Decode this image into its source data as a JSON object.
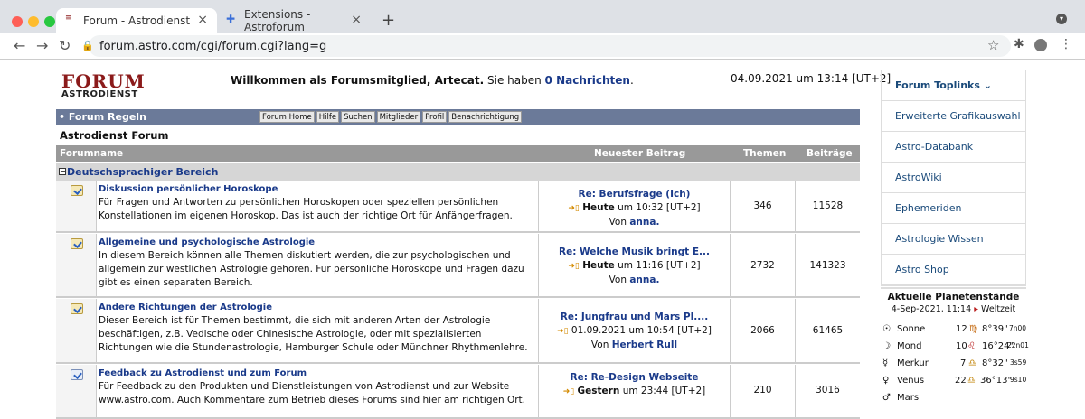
{
  "browser": {
    "tabs": [
      {
        "title": "Forum - Astrodienst",
        "close": "×"
      },
      {
        "title": "Extensions - Astroforum",
        "close": "×"
      }
    ],
    "new_tab": "+",
    "url": "forum.astro.com/cgi/forum.cgi?lang=g",
    "icons": [
      "back-arrow-icon",
      "forward-arrow-icon",
      "reload-icon",
      "star-icon",
      "puzzle-icon",
      "profile-icon",
      "menu-icon"
    ]
  },
  "header": {
    "logo_top": "FORUM",
    "logo_bottom": "ASTRODIENST",
    "welcome_bold": "Willkommen als Forumsmitglied, Artecat.",
    "welcome_mid": "Sie haben",
    "messages": "0 Nachrichten",
    "welcome_end": ".",
    "datetime": "04.09.2021 um 13:14 [UT+2]"
  },
  "nav": {
    "regeln": "• Forum Regeln",
    "buttons": [
      "Forum Home",
      "Hilfe",
      "Suchen",
      "Mitglieder",
      "Profil",
      "Benachrichtigung"
    ]
  },
  "forum_title": "Astrodienst Forum",
  "table": {
    "columns": [
      "Forumname",
      "Neuester Beitrag",
      "Themen",
      "Beiträge"
    ],
    "section": "Deutschsprachiger Bereich",
    "rows": [
      {
        "title": "Diskussion persönlicher Horoskope",
        "desc": "Für Fragen und Antworten zu persönlichen Horoskopen oder speziellen persönlichen Konstellationen im eigenen Horoskop. Das ist auch der richtige Ort für Anfängerfragen.",
        "latest_title": "Re: Berufsfrage (Ich)",
        "latest_day": "Heute",
        "latest_time": "um 10:32 [UT+2]",
        "by_label": "Von",
        "by": "anna.",
        "themen": "346",
        "beitraege": "11528"
      },
      {
        "title": "Allgemeine und psychologische Astrologie",
        "desc": "In diesem Bereich können alle Themen diskutiert werden, die zur psychologischen und allgemein zur westlichen Astrologie gehören. Für persönliche Horoskope und Fragen dazu gibt es einen separaten Bereich.",
        "latest_title": "Re: Welche Musik bringt E...",
        "latest_day": "Heute",
        "latest_time": "um 11:16 [UT+2]",
        "by_label": "Von",
        "by": "anna.",
        "themen": "2732",
        "beitraege": "141323"
      },
      {
        "title": "Andere Richtungen der Astrologie",
        "desc": "Dieser Bereich ist für Themen bestimmt, die sich mit anderen Arten der Astrologie beschäftigen, z.B. Vedische oder Chinesische Astrologie, oder mit spezialisierten Richtungen wie die Stundenastrologie, Hamburger Schule oder Münchner Rhythmenlehre.",
        "latest_title": "Re: Jungfrau und Mars Pl....",
        "latest_day": "",
        "latest_time": "01.09.2021 um 10:54 [UT+2]",
        "by_label": "Von",
        "by": "Herbert Rull",
        "themen": "2066",
        "beitraege": "61465"
      },
      {
        "title": "Feedback zu Astrodienst und zum Forum",
        "desc": "Für Feedback zu den Produkten und Dienstleistungen von Astrodienst und zur Website www.astro.com. Auch Kommentare zum Betrieb dieses Forums sind hier am richtigen Ort.",
        "latest_title": "Re: Re-Design Webseite",
        "latest_day": "Gestern",
        "latest_time": "um 23:44 [UT+2]",
        "by_label": "",
        "by": "",
        "themen": "210",
        "beitraege": "3016"
      }
    ]
  },
  "sidebar": {
    "head": "Forum Toplinks",
    "items": [
      "Erweiterte Grafikauswahl",
      "Astro-Databank",
      "AstroWiki",
      "Ephemeriden",
      "Astrologie Wissen",
      "Astro Shop"
    ]
  },
  "planets": {
    "title": "Aktuelle Planetenstände",
    "date": "4-Sep-2021, 11:14",
    "zone": "Weltzeit",
    "rows": [
      {
        "name": "Sonne",
        "deg": "12",
        "sign": "♍",
        "min": "8°39\"",
        "extra": "7n00"
      },
      {
        "name": "Mond",
        "deg": "10",
        "sign": "♌",
        "min": "16°24\"",
        "extra": "22n01"
      },
      {
        "name": "Merkur",
        "deg": "7",
        "sign": "♎",
        "min": "8°32\"",
        "extra": "3s59"
      },
      {
        "name": "Venus",
        "deg": "22",
        "sign": "♎",
        "min": "36°13\"",
        "extra": "9s10"
      },
      {
        "name": "Mars",
        "deg": "",
        "sign": "",
        "min": "",
        "extra": ""
      }
    ]
  }
}
